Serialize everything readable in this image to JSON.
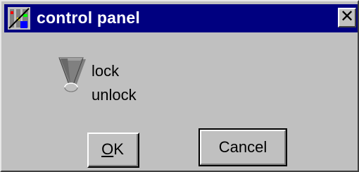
{
  "window": {
    "title": "control panel",
    "close_glyph": "✕",
    "icon": "control-panel-icon"
  },
  "toggle": {
    "icon": "lever-switch-icon",
    "state": "lock",
    "options": [
      "lock",
      "unlock"
    ]
  },
  "buttons": {
    "ok_mnemonic": "O",
    "ok_rest": "K",
    "cancel_label": "Cancel"
  },
  "colors": {
    "titlebar": "#000080",
    "face": "#c0c0c0"
  }
}
